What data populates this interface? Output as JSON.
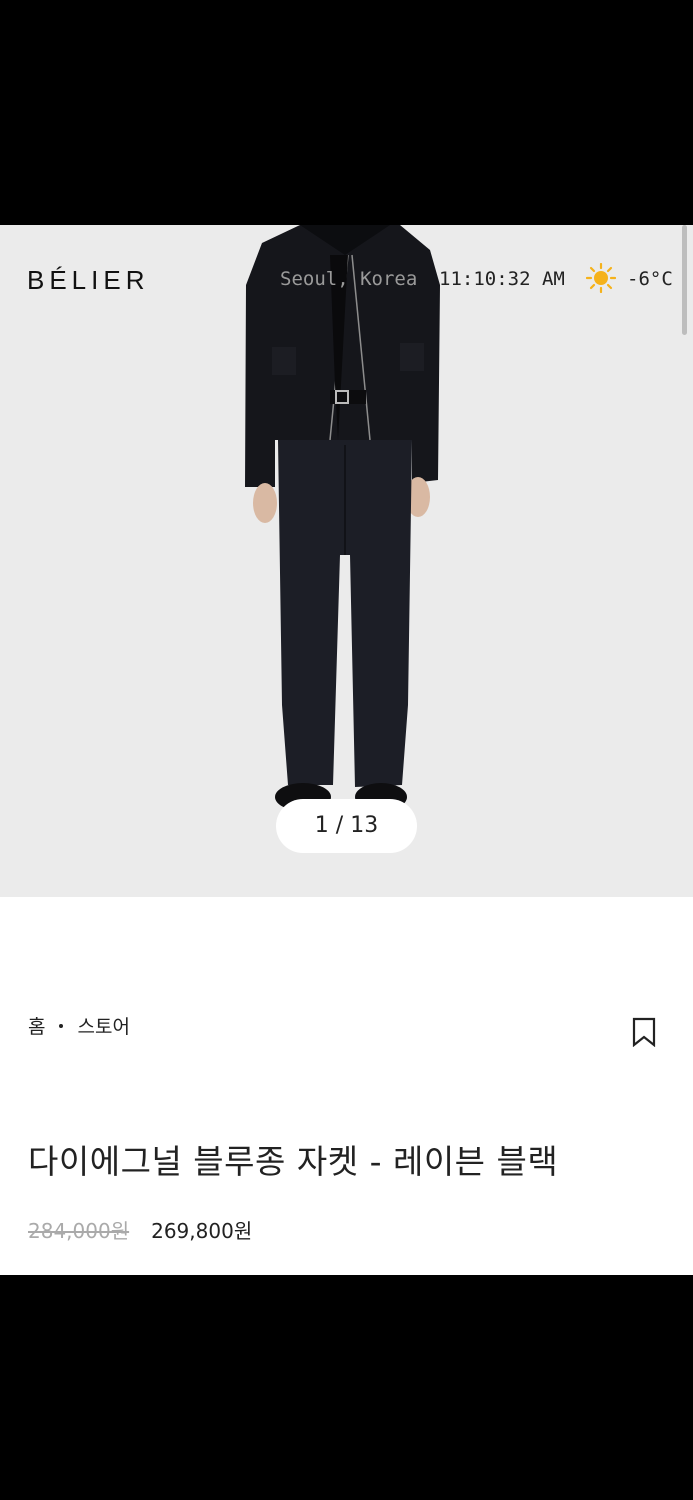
{
  "header": {
    "brand": "BÉLIER",
    "location": "Seoul, Korea",
    "time": "11:10:32 AM",
    "weather_icon": "sun-icon",
    "temperature": "-6°C"
  },
  "gallery": {
    "pager": "1 / 13",
    "background_color": "#ebebeb"
  },
  "breadcrumb": {
    "home": "홈",
    "store": "스토어"
  },
  "product": {
    "title": "다이에그널 블루종 자켓 - 레이븐 블랙",
    "original_price": "284,000원",
    "sale_price": "269,800원"
  },
  "icons": {
    "bookmark": "bookmark-icon",
    "sun": "sun-icon"
  },
  "colors": {
    "accent": "#222222",
    "muted": "#aaaaaa",
    "sun": "#f5b21b"
  }
}
